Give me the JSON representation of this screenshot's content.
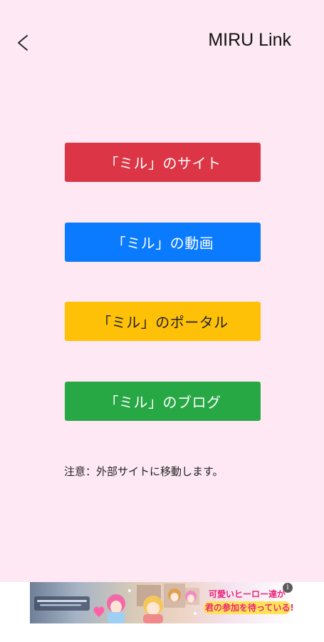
{
  "header": {
    "back_icon": "chevron-left-icon",
    "title": "MIRU Link"
  },
  "links": [
    {
      "label": "「ミル」のサイト",
      "color": "#dc3545"
    },
    {
      "label": "「ミル」の動画",
      "color": "#0a7bff"
    },
    {
      "label": "「ミル」のポータル",
      "color": "#ffc107"
    },
    {
      "label": "「ミル」のブログ",
      "color": "#28a745"
    }
  ],
  "notice": "注意：外部サイトに移動します。",
  "colors": {
    "background": "#fde8f3"
  },
  "ad": {
    "line1": "可愛いヒーロー達が",
    "line2": "君の参加を待っている!",
    "info_icon": "info-icon"
  }
}
